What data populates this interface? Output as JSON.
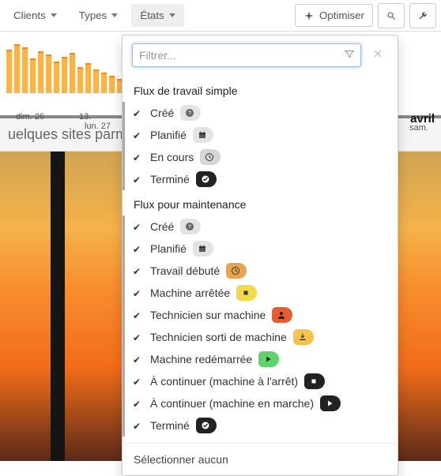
{
  "toolbar": {
    "clients": "Clients",
    "types": "Types",
    "etats": "États",
    "optimiser": "Optimiser"
  },
  "filter": {
    "placeholder": "Filtrer..."
  },
  "workflow1": {
    "title": "Flux de travail simple",
    "items": {
      "cree": "Créé",
      "planifie": "Planifié",
      "encours": "En cours",
      "termine": "Terminé"
    }
  },
  "workflow2": {
    "title": "Flux pour maintenance",
    "items": {
      "cree": "Créé",
      "planifie": "Planifié",
      "travail_debute": "Travail débuté",
      "machine_arretee": "Machine arrêtée",
      "technicien_sur_machine": "Technicien sur machine",
      "technicien_sorti": "Technicien sorti de machine",
      "machine_redemarree": "Machine redémarrée",
      "a_continuer_arret": "À continuer (machine à l'arrêt)",
      "a_continuer_marche": "À continuer (machine en marche)",
      "termine": "Terminé"
    }
  },
  "select_none": "Sélectionner aucun",
  "chart": {
    "dim26": "dim. 26",
    "day13": "13.",
    "lun27": "lun. 27",
    "avril": "avril",
    "sam": "sam."
  },
  "title_strip": "uelques sites parmi"
}
